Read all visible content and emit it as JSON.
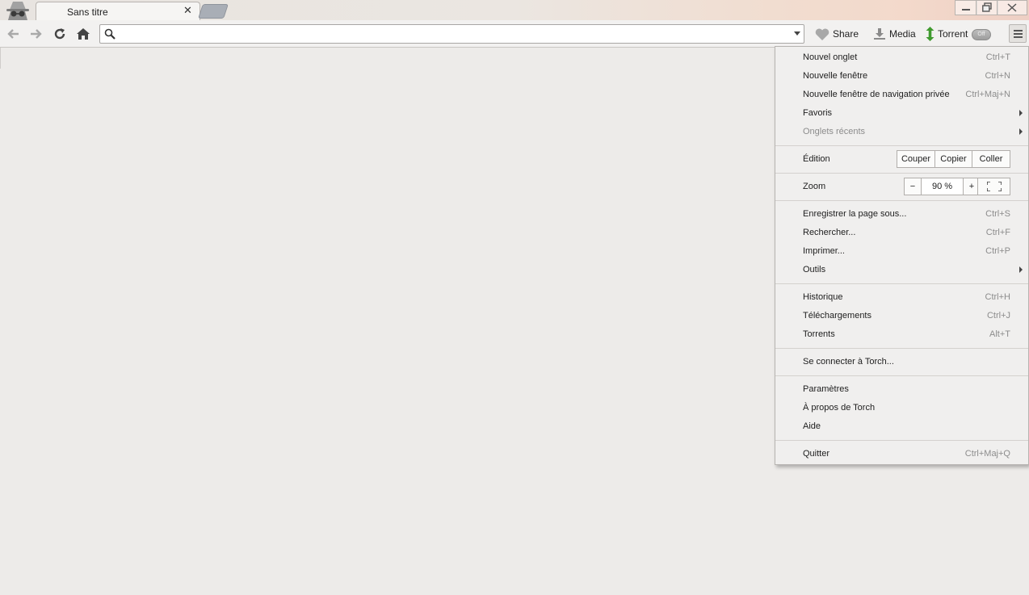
{
  "tab": {
    "title": "Sans titre",
    "close": "✕"
  },
  "window": {
    "minimize": "—",
    "restore": "❐",
    "close": "✕"
  },
  "omnibox": {
    "value": ""
  },
  "toolbar": {
    "share_label": "Share",
    "media_label": "Media",
    "torrent_label": "Torrent",
    "torrent_toggle": "Off"
  },
  "menu": {
    "group1": [
      {
        "label": "Nouvel onglet",
        "shortcut": "Ctrl+T"
      },
      {
        "label": "Nouvelle fenêtre",
        "shortcut": "Ctrl+N"
      },
      {
        "label": "Nouvelle fenêtre de navigation privée",
        "shortcut": "Ctrl+Maj+N"
      },
      {
        "label": "Favoris",
        "shortcut": ""
      },
      {
        "label": "Onglets récents",
        "shortcut": ""
      }
    ],
    "edit": {
      "label": "Édition",
      "cut": "Couper",
      "copy": "Copier",
      "paste": "Coller"
    },
    "zoom": {
      "label": "Zoom",
      "minus": "−",
      "value": "90 %",
      "plus": "+"
    },
    "group2": [
      {
        "label": "Enregistrer la page sous...",
        "shortcut": "Ctrl+S"
      },
      {
        "label": "Rechercher...",
        "shortcut": "Ctrl+F"
      },
      {
        "label": "Imprimer...",
        "shortcut": "Ctrl+P"
      },
      {
        "label": "Outils",
        "shortcut": ""
      }
    ],
    "group3": [
      {
        "label": "Historique",
        "shortcut": "Ctrl+H"
      },
      {
        "label": "Téléchargements",
        "shortcut": "Ctrl+J"
      },
      {
        "label": "Torrents",
        "shortcut": "Alt+T"
      }
    ],
    "group4": [
      {
        "label": "Se connecter à Torch...",
        "shortcut": ""
      }
    ],
    "group5": [
      {
        "label": "Paramètres",
        "shortcut": ""
      },
      {
        "label": "À propos de Torch",
        "shortcut": ""
      },
      {
        "label": "Aide",
        "shortcut": ""
      }
    ],
    "group6": [
      {
        "label": "Quitter",
        "shortcut": "Ctrl+Maj+Q"
      }
    ]
  }
}
